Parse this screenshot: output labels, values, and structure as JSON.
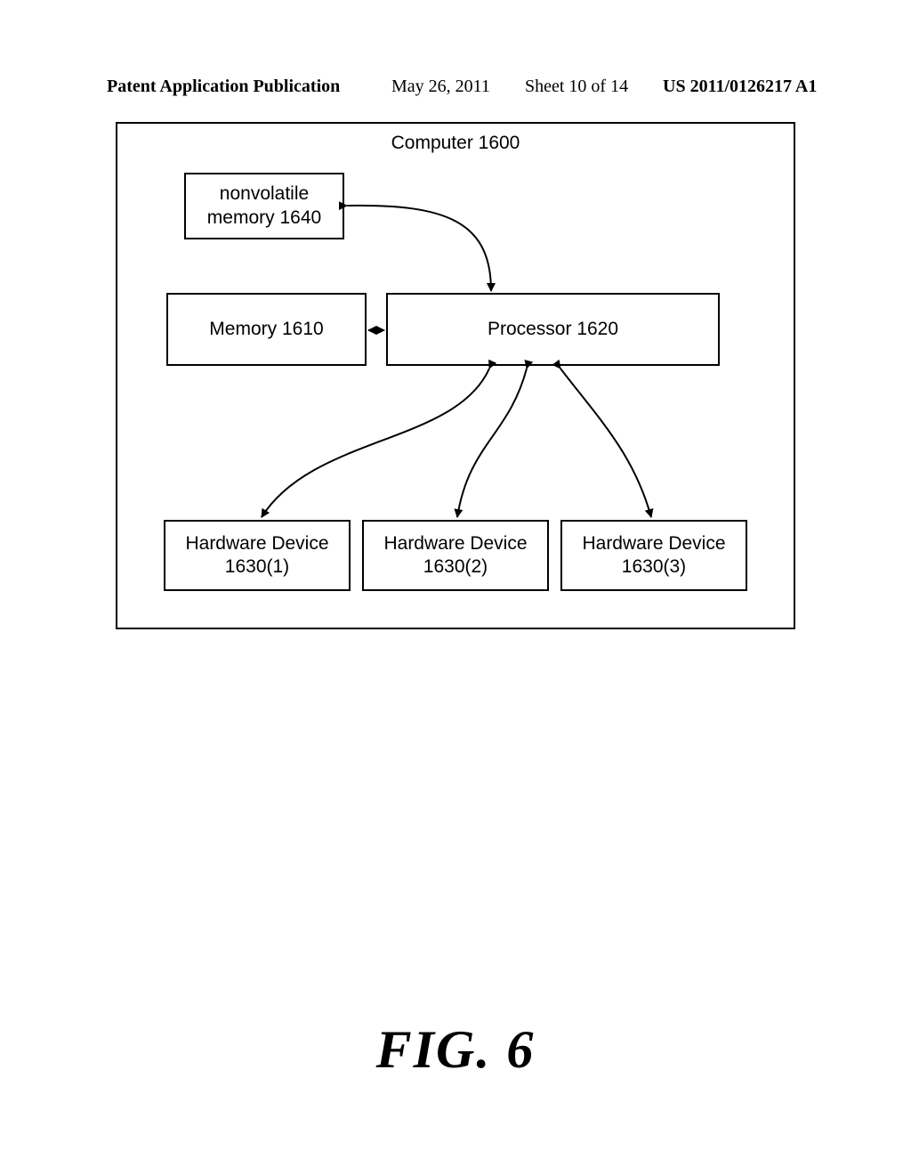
{
  "header": {
    "pubtype": "Patent Application Publication",
    "date": "May 26, 2011",
    "sheet": "Sheet 10 of 14",
    "pubno": "US 2011/0126217 A1"
  },
  "diagram": {
    "outer_title": "Computer 1600",
    "boxes": {
      "nvmem": "nonvolatile\nmemory 1640",
      "memory": "Memory 1610",
      "processor": "Processor 1620",
      "hw1": "Hardware Device\n1630(1)",
      "hw2": "Hardware Device\n1630(2)",
      "hw3": "Hardware Device\n1630(3)"
    }
  },
  "figure_caption": "FIG. 6"
}
